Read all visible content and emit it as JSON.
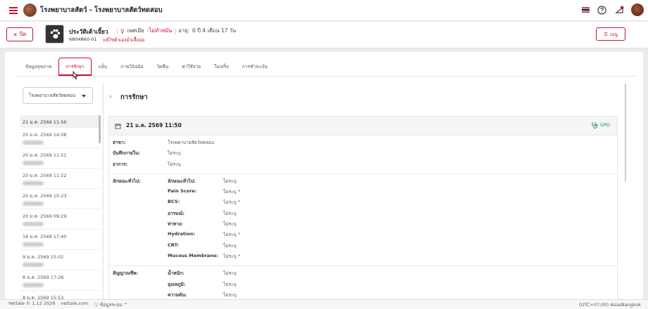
{
  "app": {
    "title": "โรงพยาบาลสัตว์ - โรงพยาบาลสัตว์ทดสอบ",
    "accent": "#c8102e"
  },
  "topbar_icons": [
    "thai-flag-icon",
    "help-icon",
    "notification-icon",
    "user-avatar"
  ],
  "patient": {
    "back_label": "ปิด",
    "name": "ประวัติเต้าเจี้ยว",
    "gender": "เพศเมีย",
    "neutered": "ไม่ทำหมัน",
    "age_label": "อายุ:",
    "age": "0 ปี 4 เดือน 17 วัน",
    "id": "6804860-01",
    "allergy_alert": "แพ้ไข่ตัวเองมั่วเลื้อออ",
    "menu_label": "เมนู"
  },
  "tabs": [
    {
      "label": "ข้อมูลสุขภาพ"
    },
    {
      "label": "การรักษา",
      "active": true
    },
    {
      "label": "แล็บ"
    },
    {
      "label": "ภาพวินิจฉัย"
    },
    {
      "label": "วัคซีน"
    },
    {
      "label": "ค่าใช้จ่าย"
    },
    {
      "label": "ใบเสร็จ"
    },
    {
      "label": "การชำระเงิน"
    }
  ],
  "history": {
    "branch_selected": "โรงพยาบาลสัตว์ทดสอบ",
    "items": [
      {
        "date": "21 ม.ค. 2569 11:50",
        "active": true
      },
      {
        "date": "20 ม.ค. 2569 14:08"
      },
      {
        "date": "20 ม.ค. 2569 11:51"
      },
      {
        "date": "20 ม.ค. 2569 11:22"
      },
      {
        "date": "20 ม.ค. 2569 10:23"
      },
      {
        "date": "20 ม.ค. 2569 09:29"
      },
      {
        "date": "16 ม.ค. 2569 17:40"
      },
      {
        "date": "9 ม.ค. 2569 15:02"
      },
      {
        "date": "8 ม.ค. 2569 17:26"
      },
      {
        "date": "8 ม.ค. 2569 15:53"
      }
    ]
  },
  "detail": {
    "title": "การรักษา",
    "visit_date": "21 ม.ค. 2569 11:50",
    "visit_type": "OPD",
    "general": [
      {
        "k": "สาขา:",
        "v": "โรงพยาบาลสัตว์ทดสอบ"
      },
      {
        "k": "บันทึกภายใน:",
        "v": "ไม่ระบุ"
      },
      {
        "k": "อาการ:",
        "v": "ไม่ระบุ"
      }
    ],
    "appearance_group": "ลักษณะทั่วไป:",
    "appearance": [
      {
        "k": "ลักษณะทั่วไป:",
        "v": "ไม่ระบุ"
      },
      {
        "k": "Pain Score:",
        "v": "ไม่ระบุ",
        "dot": true
      },
      {
        "k": "BCS:",
        "v": "ไม่ระบุ",
        "dot": true
      },
      {
        "k": "อารมณ์:",
        "v": "ไม่ระบุ"
      },
      {
        "k": "ท่าทาง:",
        "v": "ไม่ระบุ"
      },
      {
        "k": "Hydration:",
        "v": "ไม่ระบุ",
        "dot": true
      },
      {
        "k": "CRT:",
        "v": "ไม่ระบุ"
      },
      {
        "k": "Mucous Membrane:",
        "v": "ไม่ระบุ",
        "dot": true
      }
    ],
    "vitals_group": "สัญญาณชีพ:",
    "vitals": [
      {
        "k": "น้ำหนัก:",
        "v": "ไม่ระบุ"
      },
      {
        "k": "อุณหภูมิ:",
        "v": "ไม่ระบุ"
      },
      {
        "k": "ความดัน:",
        "v": "ไม่ระบุ"
      }
    ]
  },
  "footer": {
    "version": "Vettale © 1.12 2026",
    "site": "vettale.com",
    "info": "ข้อมูลระบบ",
    "timezone": "(UTC+07:00) Asia/Bangkok"
  }
}
